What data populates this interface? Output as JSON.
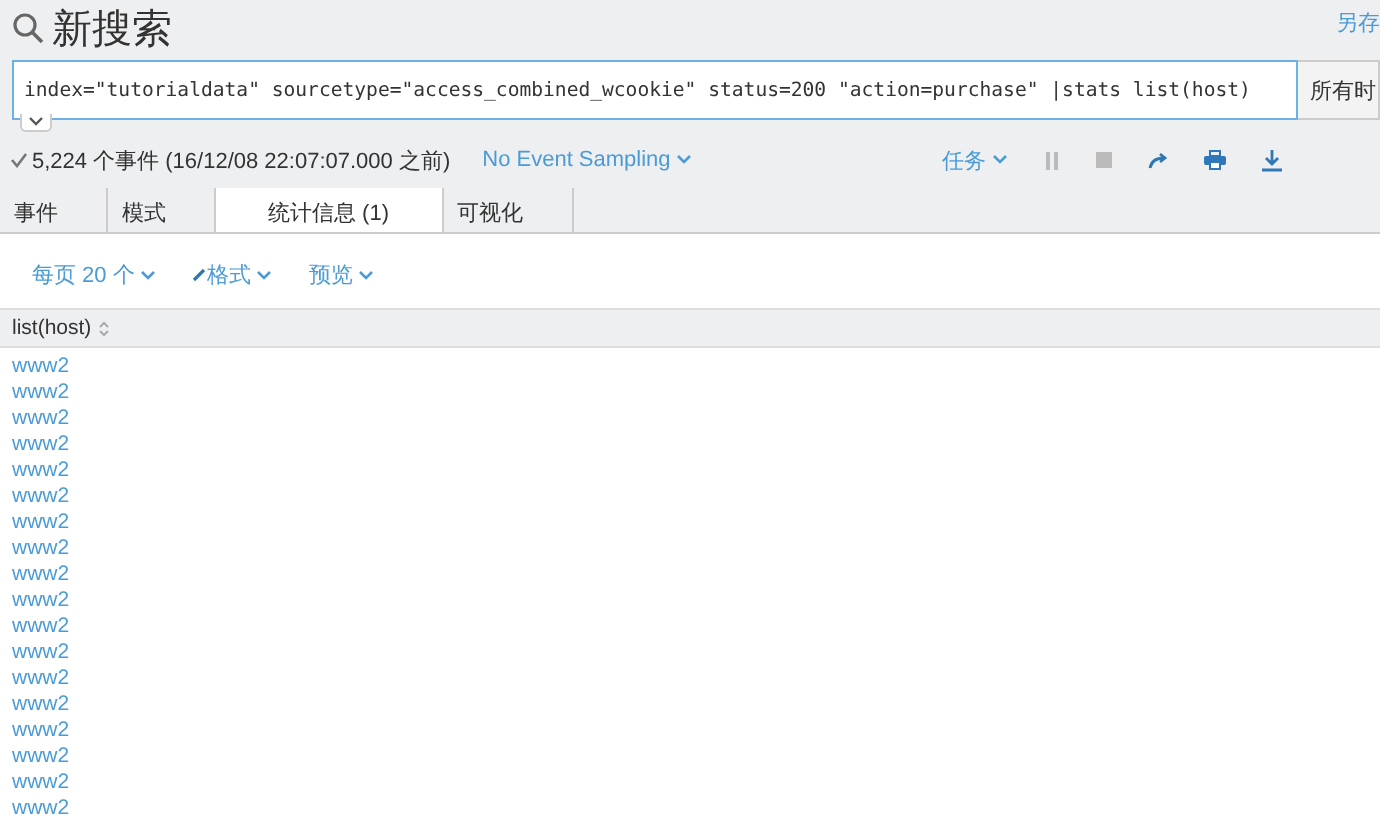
{
  "header": {
    "title": "新搜索",
    "save_link": "另存"
  },
  "search": {
    "value": "index=\"tutorialdata\"  sourcetype=\"access_combined_wcookie\" status=200 \"action=purchase\" |stats list(host)",
    "time_picker": "所有时"
  },
  "status": {
    "summary": "5,224 个事件 (16/12/08 22:07:07.000 之前)",
    "sampling": "No Event Sampling",
    "jobs": "任务"
  },
  "tabs": [
    {
      "label": "事件",
      "selected": false
    },
    {
      "label": "模式",
      "selected": false
    },
    {
      "label": "统计信息 (1)",
      "selected": true
    },
    {
      "label": "可视化",
      "selected": false
    }
  ],
  "options": [
    "每页 20 个",
    "格式",
    "预览"
  ],
  "table": {
    "columns": [
      "list(host)"
    ],
    "rows": [
      "www2",
      "www2",
      "www2",
      "www2",
      "www2",
      "www2",
      "www2",
      "www2",
      "www2",
      "www2",
      "www2",
      "www2",
      "www2",
      "www2",
      "www2",
      "www2",
      "www2",
      "www2"
    ]
  }
}
